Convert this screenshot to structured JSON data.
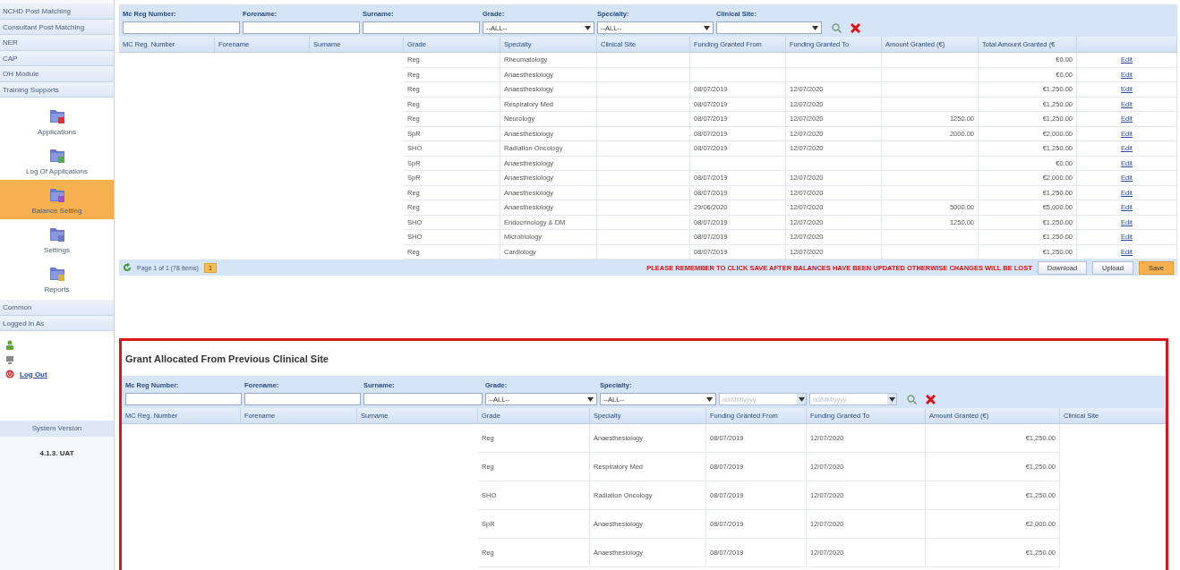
{
  "sidebar": {
    "groups_top": [
      "NCHD Post Matching",
      "Consultant Post Matching",
      "NER",
      "CAP",
      "OH Module",
      "Training Supports"
    ],
    "items": [
      {
        "label": "Applications",
        "selected": false
      },
      {
        "label": "Log Of Applications",
        "selected": false
      },
      {
        "label": "Balance Setting",
        "selected": true
      },
      {
        "label": "Settings",
        "selected": false
      },
      {
        "label": "Reports",
        "selected": false
      }
    ],
    "groups_bottom": [
      "Common",
      "Logged in As"
    ],
    "logout": "Log Out",
    "version_label": "System Version",
    "version": "4.1.3. UAT"
  },
  "balances": {
    "filters": [
      {
        "label": "Mc Reg Number:",
        "kind": "text"
      },
      {
        "label": "Forename:",
        "kind": "text"
      },
      {
        "label": "Surname:",
        "kind": "text"
      },
      {
        "label": "Grade:",
        "kind": "select",
        "value": "--ALL--"
      },
      {
        "label": "Specialty:",
        "kind": "select",
        "value": "--ALL--"
      },
      {
        "label": "Clinical Site:",
        "kind": "select"
      }
    ],
    "columns": [
      "MC Reg. Number",
      "Forename",
      "Surname",
      "Grade",
      "Specialty",
      "Clinical Site",
      "Funding Granted From",
      "Funding Granted To",
      "Amount Granted (€)",
      "Total Amount Granted (€"
    ],
    "rows": [
      {
        "grade": "Reg",
        "specialty": "Rheumatology",
        "total": "€0.00",
        "action": "Edit"
      },
      {
        "grade": "Reg",
        "specialty": "Anaesthesiology",
        "total": "€0.00",
        "action": "Edit"
      },
      {
        "grade": "Reg",
        "specialty": "Anaesthesiology",
        "from": "08/07/2019",
        "to": "12/07/2020",
        "total": "€1,250.00",
        "action": "Edit"
      },
      {
        "grade": "Reg",
        "specialty": "Respiratory Med",
        "from": "08/07/2019",
        "to": "12/07/2020",
        "total": "€1,250.00",
        "action": "Edit"
      },
      {
        "grade": "Reg",
        "specialty": "Neurology",
        "from": "08/07/2019",
        "to": "12/07/2020",
        "amount": "1250.00",
        "total": "€1,250.00",
        "action": "Edit"
      },
      {
        "grade": "SpR",
        "specialty": "Anaesthesiology",
        "from": "08/07/2019",
        "to": "12/07/2020",
        "amount": "2000.00",
        "total": "€2,000.00",
        "action": "Edit"
      },
      {
        "grade": "SHO",
        "specialty": "Radiation Oncology",
        "from": "08/07/2019",
        "to": "12/07/2020",
        "total": "€1,250.00",
        "action": "Edit"
      },
      {
        "grade": "SpR",
        "specialty": "Anaesthesiology",
        "total": "€0.00",
        "action": "Edit"
      },
      {
        "grade": "SpR",
        "specialty": "Anaesthesiology",
        "from": "08/07/2019",
        "to": "12/07/2020",
        "total": "€2,000.00",
        "action": "Edit"
      },
      {
        "grade": "Reg",
        "specialty": "Anaesthesiology",
        "from": "08/07/2019",
        "to": "12/07/2020",
        "total": "€1,250.00",
        "action": "Edit"
      },
      {
        "grade": "Reg",
        "specialty": "Anaesthesiology",
        "from": "29/06/2020",
        "to": "12/07/2020",
        "amount": "5000.00",
        "total": "€5,000.00",
        "action": "Edit"
      },
      {
        "grade": "SHO",
        "specialty": "Endocrinology & DM",
        "from": "08/07/2019",
        "to": "12/07/2020",
        "amount": "1250.00",
        "total": "€1,250.00",
        "action": "Edit"
      },
      {
        "grade": "SHO",
        "specialty": "Microbiology",
        "from": "08/07/2019",
        "to": "12/07/2020",
        "total": "€1,250.00",
        "action": "Edit"
      },
      {
        "grade": "Reg",
        "specialty": "Cardiology",
        "from": "08/07/2019",
        "to": "12/07/2020",
        "total": "€1,250.00",
        "action": "Edit"
      }
    ],
    "pager": {
      "summary": "Page 1 of 1 (78 items)",
      "pages": [
        {
          "label": "1",
          "selected": true
        }
      ]
    },
    "message": "PLEASE REMEMBER TO CLICK SAVE AFTER BALANCES HAVE BEEN UPDATED OTHERWISE CHANGES WILL BE LOST",
    "buttons": [
      {
        "label": "Download",
        "kind": "plain"
      },
      {
        "label": "Upload",
        "kind": "plain"
      },
      {
        "label": "Save",
        "kind": "primary"
      }
    ]
  },
  "previous_grants": {
    "title": "Grant Allocated From Previous Clinical Site",
    "filters": [
      {
        "label": "Mc Reg Number:",
        "kind": "text"
      },
      {
        "label": "Forename:",
        "kind": "text"
      },
      {
        "label": "Surname:",
        "kind": "text"
      },
      {
        "label": "Grade:",
        "kind": "select",
        "value": "--ALL--"
      },
      {
        "label": "Specialty:",
        "kind": "select",
        "value": "--ALL--"
      },
      {
        "kind": "date",
        "placeholder": "dd/MM/yyyy"
      },
      {
        "kind": "date",
        "placeholder": "dd/MM/yyyy"
      }
    ],
    "columns": [
      "MC Reg. Number",
      "Forename",
      "Surname",
      "Grade",
      "Specialty",
      "Funding Granted From",
      "Funding Granted To",
      "Amount Granted (€)",
      "Clinical Site"
    ],
    "rows": [
      {
        "grade": "Reg",
        "specialty": "Anaesthesiology",
        "from": "08/07/2019",
        "to": "12/07/2020",
        "amount": "€1,250.00"
      },
      {
        "grade": "Reg",
        "specialty": "Respiratory Med",
        "from": "08/07/2019",
        "to": "12/07/2020",
        "amount": "€1,250.00"
      },
      {
        "grade": "SHO",
        "specialty": "Radiation Oncology",
        "from": "08/07/2019",
        "to": "12/07/2020",
        "amount": "€1,250.00"
      },
      {
        "grade": "SpR",
        "specialty": "Anaesthesiology",
        "from": "08/07/2019",
        "to": "12/07/2020",
        "amount": "€2,000.00"
      },
      {
        "grade": "Reg",
        "specialty": "Anaesthesiology",
        "from": "08/07/2019",
        "to": "12/07/2020",
        "amount": "€1,250.00"
      }
    ]
  }
}
